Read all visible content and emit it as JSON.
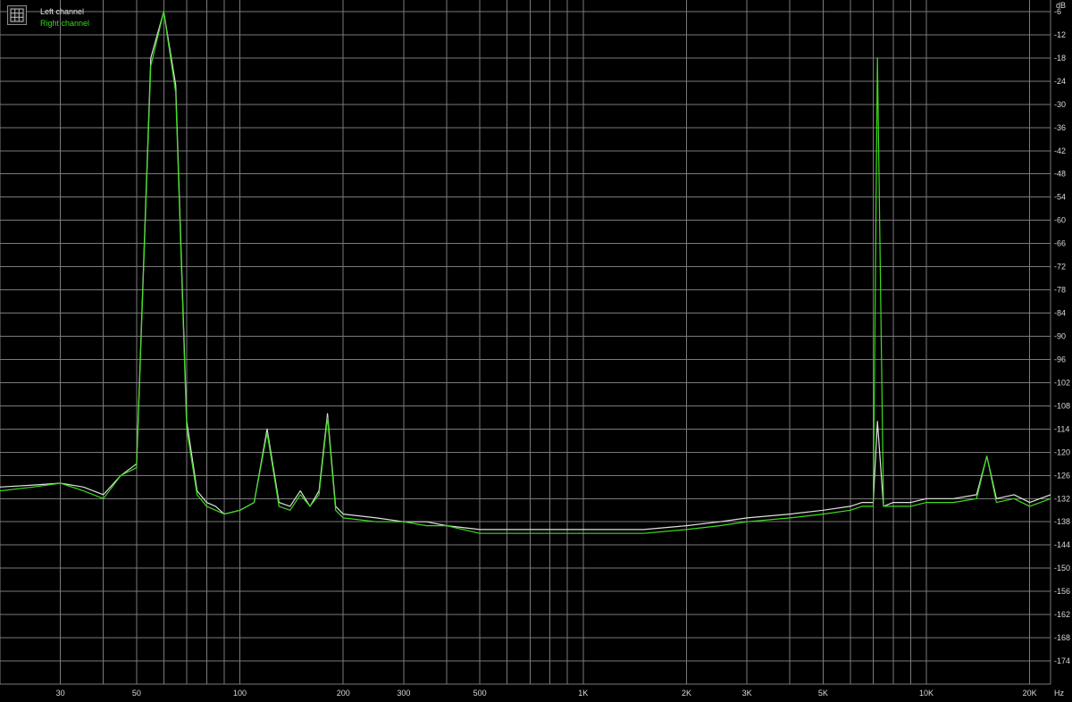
{
  "chart_data": {
    "type": "line",
    "xscale": "log",
    "xlim": [
      20,
      23000
    ],
    "ylim": [
      -180,
      -3
    ],
    "y_unit": "dB",
    "x_unit": "Hz",
    "grid": true,
    "x_ticks": [
      {
        "v": 30,
        "label": "30"
      },
      {
        "v": 50,
        "label": "50"
      },
      {
        "v": 100,
        "label": "100"
      },
      {
        "v": 200,
        "label": "200"
      },
      {
        "v": 300,
        "label": "300"
      },
      {
        "v": 500,
        "label": "500"
      },
      {
        "v": 1000,
        "label": "1K"
      },
      {
        "v": 2000,
        "label": "2K"
      },
      {
        "v": 3000,
        "label": "3K"
      },
      {
        "v": 5000,
        "label": "5K"
      },
      {
        "v": 10000,
        "label": "10K"
      },
      {
        "v": 20000,
        "label": "20K"
      }
    ],
    "y_ticks": [
      -6,
      -12,
      -18,
      -24,
      -30,
      -36,
      -42,
      -48,
      -54,
      -60,
      -66,
      -72,
      -78,
      -84,
      -90,
      -96,
      -102,
      -108,
      -114,
      -120,
      -126,
      -132,
      -138,
      -144,
      -150,
      -156,
      -162,
      -168,
      -174
    ],
    "legend": "top-left",
    "background": "#000000",
    "grid_color": "#7a7a7a",
    "series": [
      {
        "name": "Left channel",
        "color": "#e0e0e0",
        "x": [
          20,
          25,
          30,
          35,
          40,
          45,
          50,
          55,
          60,
          65,
          70,
          75,
          80,
          85,
          90,
          100,
          110,
          120,
          130,
          140,
          150,
          160,
          170,
          180,
          190,
          200,
          250,
          300,
          350,
          400,
          500,
          600,
          700,
          800,
          1000,
          1500,
          2000,
          2500,
          3000,
          4000,
          5000,
          6000,
          6500,
          7000,
          7200,
          7500,
          8000,
          9000,
          10000,
          12000,
          14000,
          15000,
          16000,
          18000,
          20000,
          23000
        ],
        "y": [
          -129,
          -128.5,
          -128,
          -129,
          -131,
          -126,
          -123,
          -18,
          -6,
          -25,
          -112,
          -130,
          -133,
          -134,
          -136,
          -135,
          -133,
          -114,
          -133,
          -134,
          -130,
          -134,
          -130,
          -110,
          -134,
          -136,
          -137,
          -138,
          -138,
          -139,
          -140,
          -140,
          -140,
          -140,
          -140,
          -140,
          -139,
          -138,
          -137,
          -136,
          -135,
          -134,
          -133,
          -133,
          -112,
          -134,
          -133,
          -133,
          -132,
          -132,
          -131,
          -121,
          -132,
          -131,
          -133,
          -131
        ]
      },
      {
        "name": "Right channel",
        "color": "#3ddc1c",
        "x": [
          20,
          25,
          30,
          35,
          40,
          45,
          50,
          55,
          60,
          65,
          70,
          75,
          80,
          85,
          90,
          100,
          110,
          120,
          130,
          140,
          150,
          160,
          170,
          180,
          190,
          200,
          250,
          300,
          350,
          400,
          500,
          600,
          700,
          800,
          1000,
          1500,
          2000,
          2500,
          3000,
          4000,
          5000,
          6000,
          6500,
          7000,
          7200,
          7500,
          8000,
          9000,
          10000,
          12000,
          14000,
          15000,
          16000,
          18000,
          20000,
          23000
        ],
        "y": [
          -130,
          -129,
          -128,
          -130,
          -132,
          -126,
          -124,
          -20,
          -6,
          -27,
          -114,
          -131,
          -134,
          -135,
          -136,
          -135,
          -133,
          -115,
          -134,
          -135,
          -131,
          -134,
          -131,
          -111,
          -135,
          -137,
          -138,
          -138,
          -139,
          -139,
          -141,
          -141,
          -141,
          -141,
          -141,
          -141,
          -140,
          -139,
          -138,
          -137,
          -136,
          -135,
          -134,
          -134,
          -18,
          -134,
          -134,
          -134,
          -133,
          -133,
          -132,
          -121,
          -133,
          -132,
          -134,
          -132
        ]
      }
    ]
  },
  "axis": {
    "y_unit_label": "dB",
    "x_unit_label": "Hz"
  },
  "legend": {
    "left_label": "Left channel",
    "right_label": "Right channel"
  }
}
